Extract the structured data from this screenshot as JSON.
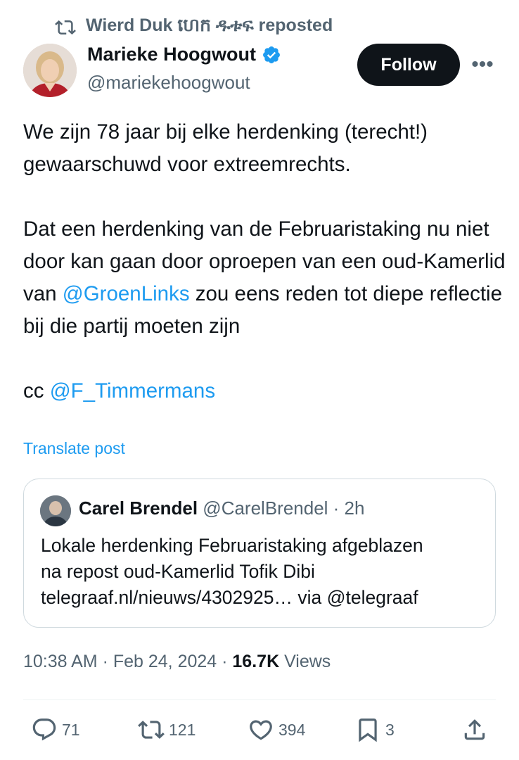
{
  "repost": {
    "text": "Wierd Duk ហេក ዱቱፍ reposted",
    "icon": "repost-icon"
  },
  "author": {
    "name": "Marieke Hoogwout",
    "handle": "@mariekehoogwout",
    "verified": true,
    "follow_label": "Follow",
    "more_label": "•••"
  },
  "post": {
    "para1": "We zijn 78 jaar bij elke herdenking (terecht!) gewaarschuwd voor extreemrechts.",
    "para2_pre": "Dat een herdenking van de Februaristaking nu niet door kan gaan door oproepen van een oud-Kamerlid van ",
    "para2_mention": "@GroenLinks",
    "para2_post": " zou eens reden tot diepe reflectie bij die partij moeten zijn",
    "cc_prefix": "cc ",
    "cc_mention": "@F_Timmermans",
    "translate_label": "Translate post"
  },
  "quote": {
    "name": "Carel Brendel",
    "meta": " @CarelBrendel · 2h",
    "line1": "Lokale herdenking Februaristaking afgeblazen",
    "line2": "na repost oud-Kamerlid Tofik Dibi",
    "line3": "telegraaf.nl/nieuws/4302925… via @telegraaf"
  },
  "meta": {
    "time_date": "10:38 AM · Feb 24, 2024 · ",
    "views_count": "16.7K",
    "views_label": " Views"
  },
  "actions": {
    "replies": "71",
    "reposts": "121",
    "likes": "394",
    "bookmarks": "3"
  },
  "colors": {
    "accent": "#1d9bf0",
    "text": "#0f1419",
    "muted": "#536471",
    "border": "#cfd9de"
  }
}
